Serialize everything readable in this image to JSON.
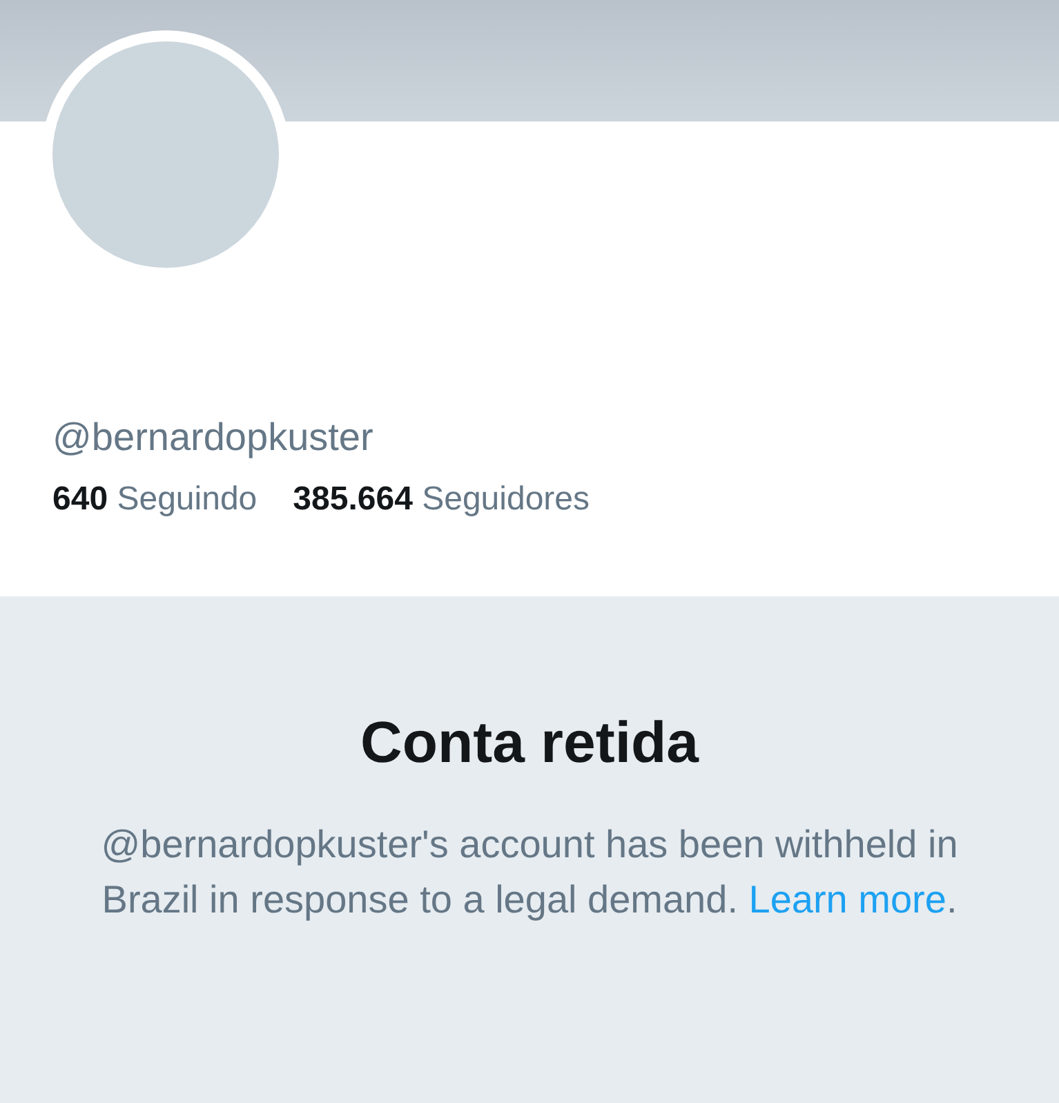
{
  "profile": {
    "handle": "@bernardopkuster",
    "stats": [
      {
        "count": "640",
        "label": "Seguindo"
      },
      {
        "count": "385.664",
        "label": "Seguidores"
      }
    ]
  },
  "notice": {
    "title": "Conta retida",
    "text": "@bernardopkuster's account has been withheld in Brazil in response to a legal demand. ",
    "link": "Learn more",
    "after": "."
  }
}
